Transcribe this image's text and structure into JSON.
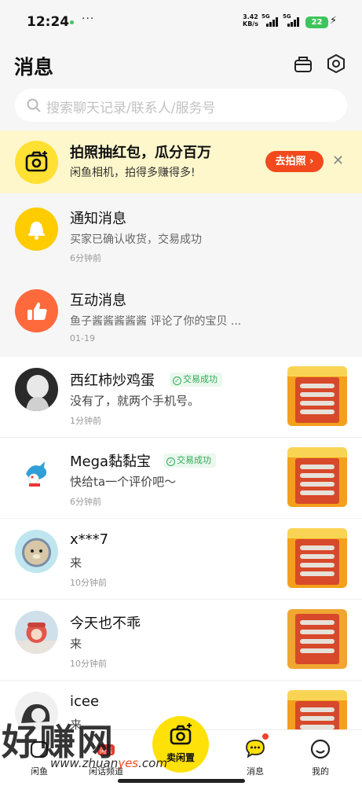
{
  "status_bar": {
    "time": "12:24",
    "more": "···",
    "speed_value": "3.42",
    "speed_unit": "KB/s",
    "net1": "5G",
    "net2": "5G",
    "battery": "22"
  },
  "header": {
    "title": "消息",
    "search_placeholder": "搜索聊天记录/联系人/服务号"
  },
  "promo": {
    "title": "拍照抽红包，瓜分百万",
    "subtitle": "闲鱼相机，拍得多赚得多!",
    "button": "去拍照 ›"
  },
  "system_messages": [
    {
      "title": "通知消息",
      "subtitle": "买家已确认收货，交易成功",
      "time": "6分钟前",
      "icon": "bell-icon",
      "color": "#ffcc00"
    },
    {
      "title": "互动消息",
      "subtitle": "鱼子酱酱酱酱酱 评论了你的宝贝 ...",
      "time": "01-19",
      "icon": "thumbs-up-icon",
      "color": "#ff6a3d"
    }
  ],
  "chats": [
    {
      "name": "西红柿炒鸡蛋",
      "badge": "交易成功",
      "message": "没有了，就两个手机号。",
      "time": "1分钟前"
    },
    {
      "name": "Mega黏黏宝",
      "badge": "交易成功",
      "message": "快给ta一个评价吧～",
      "time": "6分钟前"
    },
    {
      "name": "x***7",
      "badge": "",
      "message": "来",
      "time": "10分钟前"
    },
    {
      "name": "今天也不乖",
      "badge": "",
      "message": "来",
      "time": "10分钟前"
    },
    {
      "name": "icee",
      "badge": "",
      "message": "来",
      "time": ""
    }
  ],
  "nav": {
    "home": "闲鱼",
    "community": "闲话频道",
    "sell": "卖闲置",
    "messages": "消息",
    "mine": "我的"
  },
  "watermark": {
    "text": "好赚网",
    "url_prefix": "www.zhuan",
    "url_mid": "yes",
    "url_suffix": ".com"
  }
}
